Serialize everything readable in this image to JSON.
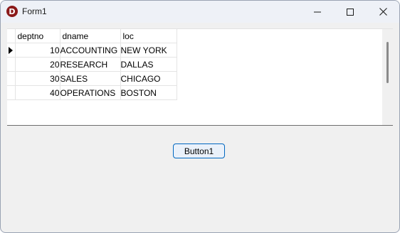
{
  "window": {
    "title": "Form1",
    "icon_letter": "D",
    "icon_color": "#8b1a1a"
  },
  "grid": {
    "columns": [
      "deptno",
      "dname",
      "loc"
    ],
    "rows": [
      {
        "deptno": "10",
        "dname": "ACCOUNTING",
        "loc": "NEW YORK",
        "current": true
      },
      {
        "deptno": "20",
        "dname": "RESEARCH",
        "loc": "DALLAS",
        "current": false
      },
      {
        "deptno": "30",
        "dname": "SALES",
        "loc": "CHICAGO",
        "current": false
      },
      {
        "deptno": "40",
        "dname": "OPERATIONS",
        "loc": "BOSTON",
        "current": false
      }
    ]
  },
  "button1": {
    "label": "Button1",
    "accent": "#0067c0"
  }
}
